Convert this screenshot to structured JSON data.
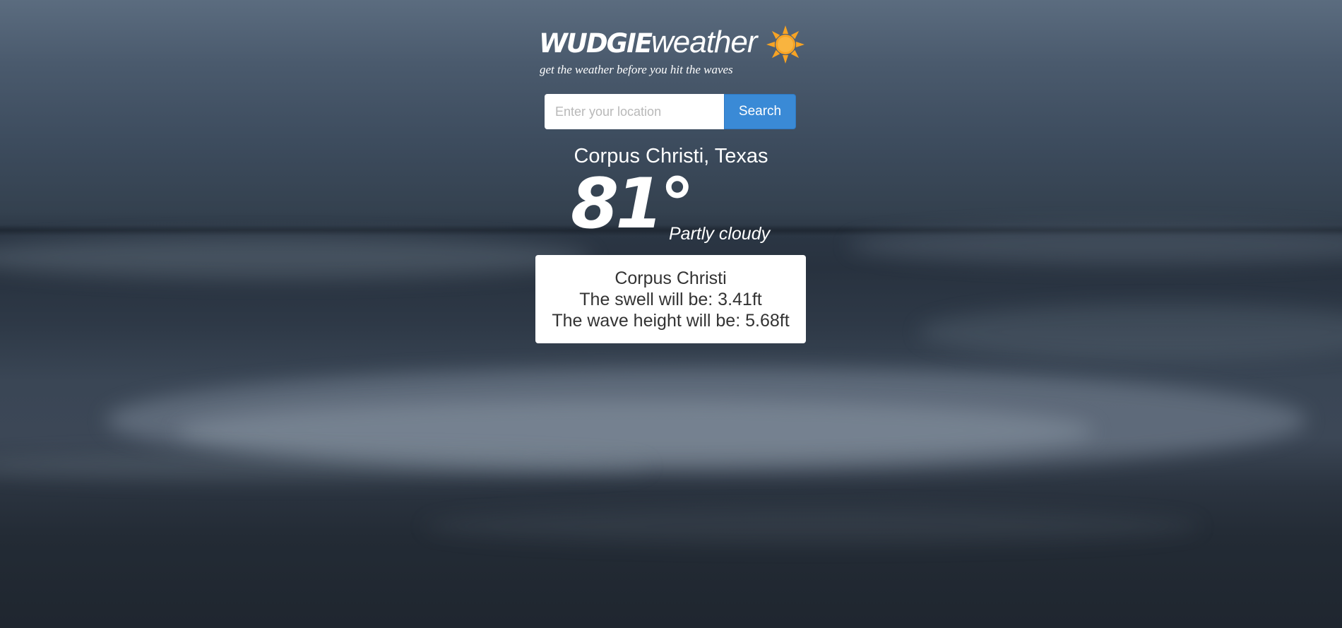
{
  "header": {
    "logo_bold": "WUDGIE",
    "logo_light": "weather",
    "logo_icon": "sun-icon",
    "tagline": "get the weather before you hit the waves"
  },
  "search": {
    "placeholder": "Enter your location",
    "value": "",
    "button_label": "Search"
  },
  "current": {
    "location": "Corpus Christi, Texas",
    "temperature": "81°",
    "condition": "Partly cloudy"
  },
  "surf": {
    "city": "Corpus Christi",
    "swell_text": "The swell will be: 3.41ft",
    "wave_text": "The wave height will be: 5.68ft"
  },
  "colors": {
    "accent": "#3a8ad6",
    "sun": "#f7a324",
    "card_background": "#ffffff",
    "card_text": "#333333"
  }
}
